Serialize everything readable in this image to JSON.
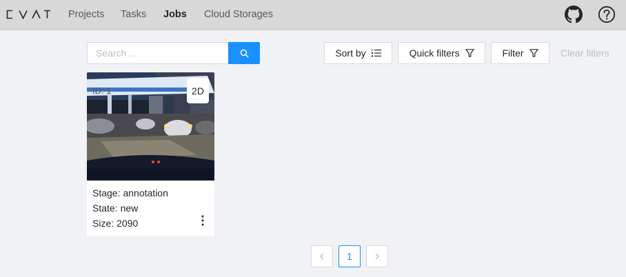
{
  "header": {
    "logo_text": "CVAT",
    "nav": [
      {
        "label": "Projects",
        "active": false
      },
      {
        "label": "Tasks",
        "active": false
      },
      {
        "label": "Jobs",
        "active": true
      },
      {
        "label": "Cloud Storages",
        "active": false
      }
    ],
    "icons": [
      "github-icon",
      "help-icon"
    ]
  },
  "toolbar": {
    "search_placeholder": "Search ...",
    "search_value": "",
    "sort_label": "Sort by",
    "quick_filters_label": "Quick filters",
    "filter_label": "Filter",
    "clear_filters_label": "Clear filters"
  },
  "jobs": [
    {
      "id_label": "ID: 1",
      "dimension": "2D",
      "stage_label": "Stage:",
      "stage": "annotation",
      "state_label": "State:",
      "state": "new",
      "size_label": "Size:",
      "size": "2090"
    }
  ],
  "pagination": {
    "current_page": "1",
    "prev_icon": "chevron-left-icon",
    "next_icon": "chevron-right-icon"
  },
  "colors": {
    "accent": "#1890ff",
    "header_bg": "#d8d8d8",
    "page_bg": "#f0f2f5",
    "disabled_text": "#bfbfbf"
  }
}
